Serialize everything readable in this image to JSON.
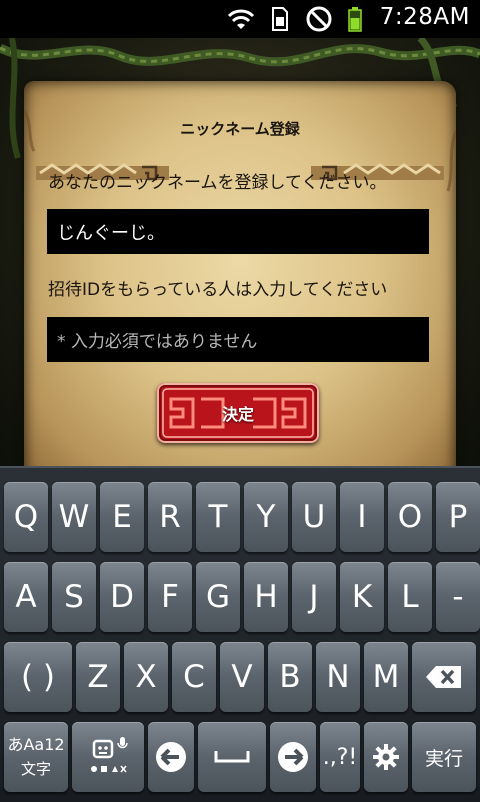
{
  "status_bar": {
    "time": "7:28AM",
    "icons": [
      "wifi-icon",
      "sim-icon",
      "no-sound-icon",
      "battery-icon"
    ]
  },
  "form": {
    "title": "ニックネーム登録",
    "nickname_prompt": "あなたのニックネームを登録してください。",
    "nickname_value": "じんぐーじ。",
    "invite_prompt": "招待IDをもらっている人は入力してください",
    "invite_placeholder": "* 入力必須ではありません",
    "confirm_label": "決定"
  },
  "keyboard": {
    "row1": [
      "Q",
      "W",
      "E",
      "R",
      "T",
      "Y",
      "U",
      "I",
      "O",
      "P"
    ],
    "row2": [
      "A",
      "S",
      "D",
      "F",
      "G",
      "H",
      "J",
      "K",
      "L",
      "-"
    ],
    "row3_paren": "( )",
    "row3": [
      "Z",
      "X",
      "C",
      "V",
      "B",
      "N",
      "M"
    ],
    "mode_key_top": "あAa12",
    "mode_key_bottom": "文字",
    "symbol_key": ".,?!",
    "enter_key": "実行"
  },
  "colors": {
    "parchment": "#dcc287",
    "field_background": "#000000",
    "confirm_button": "#b9141c",
    "keyboard_key": "#5b636c"
  }
}
